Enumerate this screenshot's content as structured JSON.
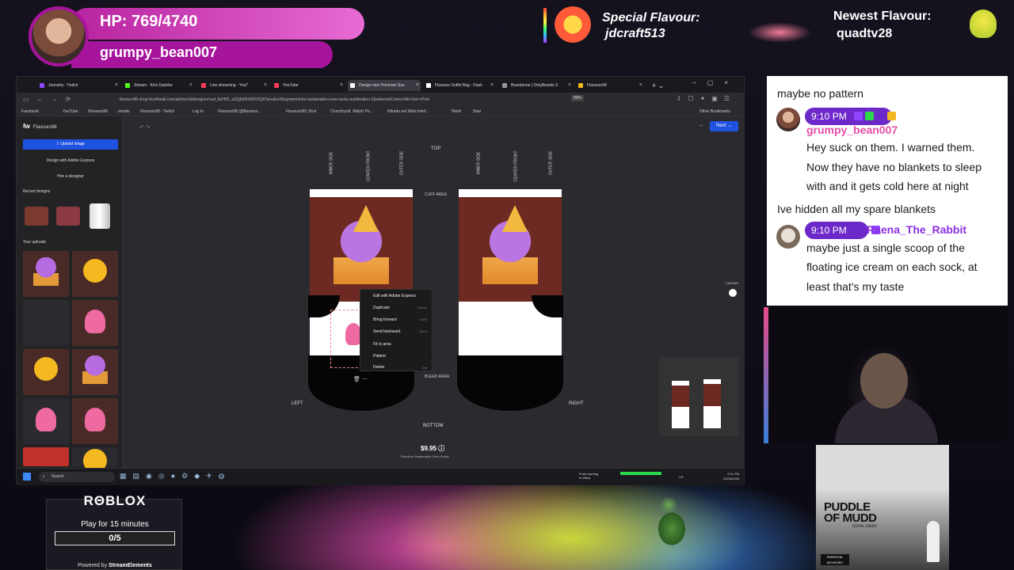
{
  "overlay": {
    "hp": "HP: 769/4740",
    "username": "grumpy_bean007",
    "special_label": "Special Flavour:",
    "special_name": "jdcraft513",
    "newest_label": "Newest Flavour:",
    "newest_name": "quadtv28"
  },
  "browser": {
    "tabs": [
      {
        "label": "Jooosha - Twitch"
      },
      {
        "label": "Stream - Kick Dashbo"
      },
      {
        "label": "Live streaming - YouT"
      },
      {
        "label": "YouTube"
      },
      {
        "label": "Design new Premium Sus"
      },
      {
        "label": "Flavours Duffel Bag - Dash"
      },
      {
        "label": "Beardanne | OnlyBeards S"
      },
      {
        "label": "Flavours98"
      }
    ],
    "url": "flavours98-shop.fourthwall.com/admin/v3/designer/cud_6eH65_a2Qj6d0h5t9OJQA?productSlug=premium-sustainable-crew-socks-sublimation-1&selectedColors=All-Over+Print",
    "zoom": "80%",
    "bookmarks": [
      "Facebook",
      "YouTube",
      "Flavours98",
      "emails",
      "Flavours98 - Twitch",
      "Log In",
      "Flavours98 (@flavours...",
      "Flavours98 | Kick",
      "Crunchyroll: Watch Po...",
      "Nitrado.net Web interf...",
      "Tiktok",
      "Stan"
    ],
    "other_bookmarks": "Other Bookmarks"
  },
  "designer": {
    "brand": "fw",
    "shop": "Flavours98",
    "upload": "Upload image",
    "adobe": "Design with Adobe Express",
    "hire": "Hire a designer",
    "recent": "Recent designs",
    "uploads": "Your uploads",
    "next": "Next",
    "labels": {
      "top": "TOP",
      "bottom": "BOTTOM",
      "left": "LEFT",
      "right": "RIGHT",
      "cuff": "CUFF AREA",
      "bleed": "BLEED AREA",
      "inner": "INNER SIDE",
      "center_front": "CENTER FRONT",
      "outer": "OUTER SIDE",
      "inner_back": "INNER SIDE",
      "center_back": "CENTER FRONT",
      "outer_back": "OUTER SIDE",
      "canvas": "CANVAS"
    },
    "context_menu": [
      {
        "label": "Edit with Adobe Express",
        "key": ""
      },
      {
        "label": "Duplicate",
        "key": "Ctrl+D"
      },
      {
        "label": "Bring forward",
        "key": "Ctrl+]"
      },
      {
        "label": "Send backward",
        "key": "Ctrl+["
      },
      {
        "label": "Fit to area",
        "key": "›"
      },
      {
        "label": "Pattern",
        "key": "›"
      },
      {
        "label": "Delete",
        "key": "Del"
      }
    ],
    "price": "$9.95",
    "product": "Premium Sustainable Crew Socks"
  },
  "taskbar": {
    "search": "Search",
    "frost": "Frost warning",
    "frost_sub": "In effect",
    "time": "9:11 PM",
    "date": "22/09/2025",
    "lang": "US"
  },
  "chat": {
    "messages": [
      {
        "text": "maybe no pattern"
      },
      {
        "time": "9:10 PM",
        "user": "grumpy_bean007",
        "lines": [
          "Hey suck on them. I warned them.",
          "Now they have no blankets to sleep",
          "with and it gets cold here at night"
        ]
      },
      {
        "text": "Ive hidden all my spare blankets"
      },
      {
        "time": "9:10 PM",
        "user": "Raena_The_Rabbit",
        "lines": [
          "maybe just a single scoop of the",
          "floating ice cream on each sock, at",
          "least that's my taste"
        ]
      }
    ],
    "colors": {
      "grumpy": "#e44ea8",
      "raena": "#8b2fe0",
      "badge": "#6d28c9"
    }
  },
  "album": {
    "title1": "PUDDLE",
    "title2": "OF MUDD",
    "subtitle": "come clean",
    "advisory": "PARENTAL ADVISORY"
  },
  "roblox": {
    "logo": "RΘBLOX",
    "play": "Play for 15 minutes",
    "progress": "0/5",
    "progress_value": 0,
    "powered": "Powered by",
    "powered_brand": "StreamElements"
  }
}
